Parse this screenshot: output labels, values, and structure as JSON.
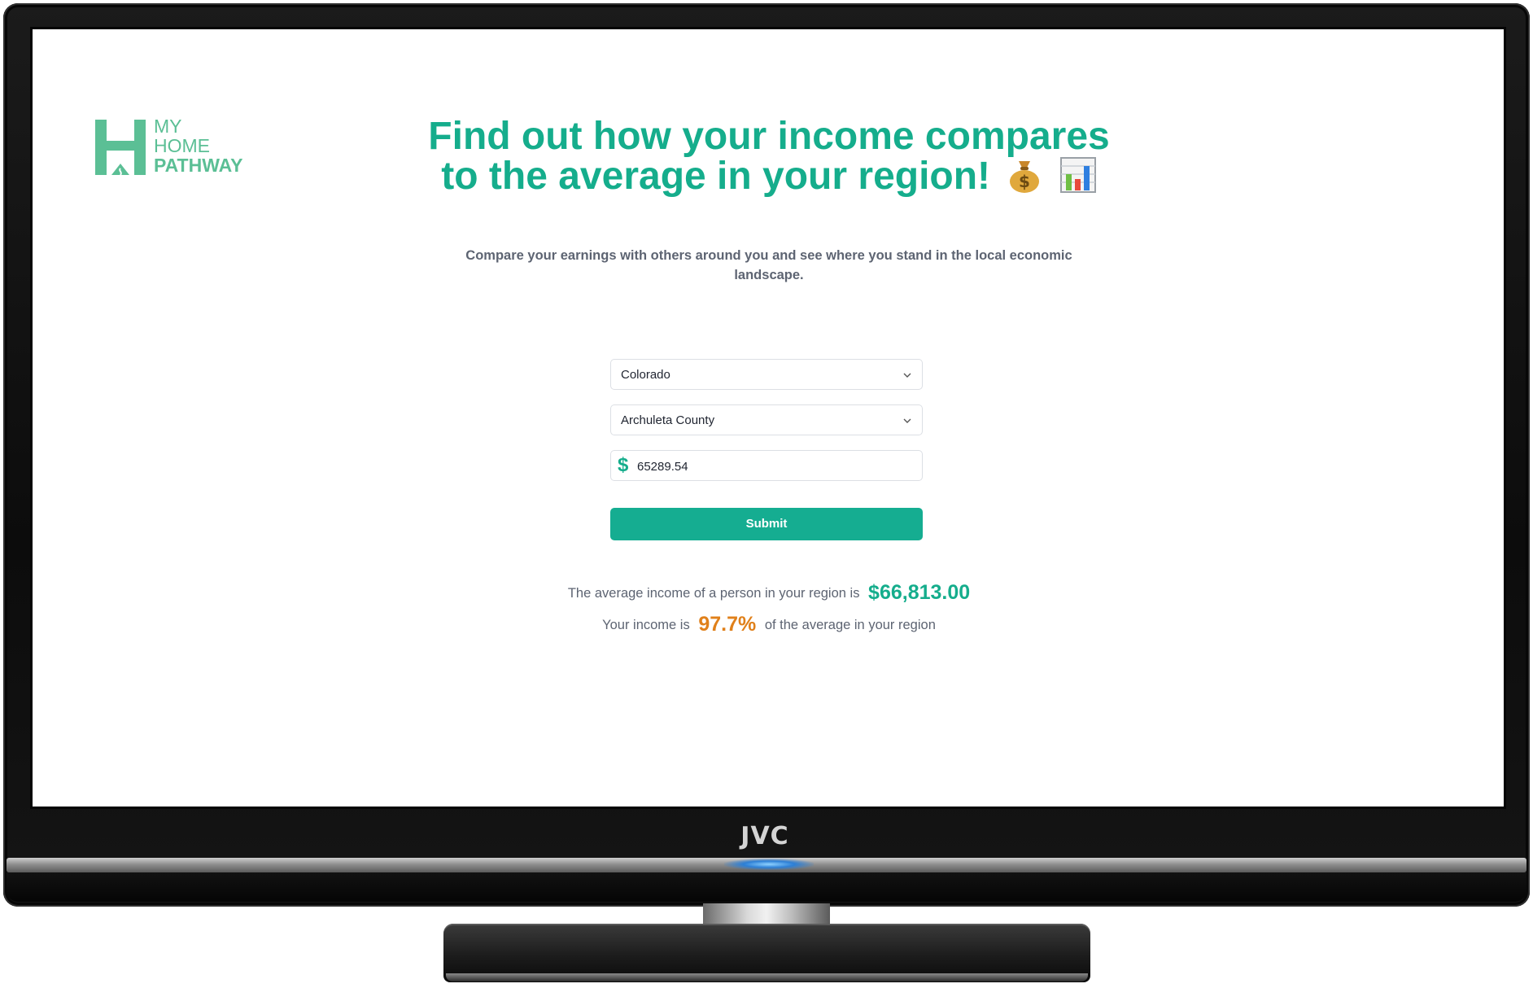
{
  "device": {
    "brand": "JVC"
  },
  "logo": {
    "line1": "MY",
    "line2": "HOME",
    "line3": "PATHWAY",
    "brand_color": "#5bbf95"
  },
  "hero": {
    "title": "Find out how your income compares to the average in your region!",
    "emoji_1": "money-bag-emoji",
    "emoji_2": "bar-chart-emoji",
    "subtitle": "Compare your earnings with others around you and see where you stand in the local economic landscape."
  },
  "form": {
    "state_selected": "Colorado",
    "county_selected": "Archuleta County",
    "currency_symbol": "$",
    "income_value": "65289.54",
    "submit_label": "Submit"
  },
  "results": {
    "avg_prefix": "The average income of a person in your region is",
    "avg_value": "$66,813.00",
    "pct_prefix": "Your income is",
    "pct_value": "97.7%",
    "pct_suffix": "of the average in your region"
  },
  "colors": {
    "accent": "#15ad8c",
    "button": "#15ad91",
    "percent": "#e0801a",
    "text_muted": "#5d6472"
  }
}
